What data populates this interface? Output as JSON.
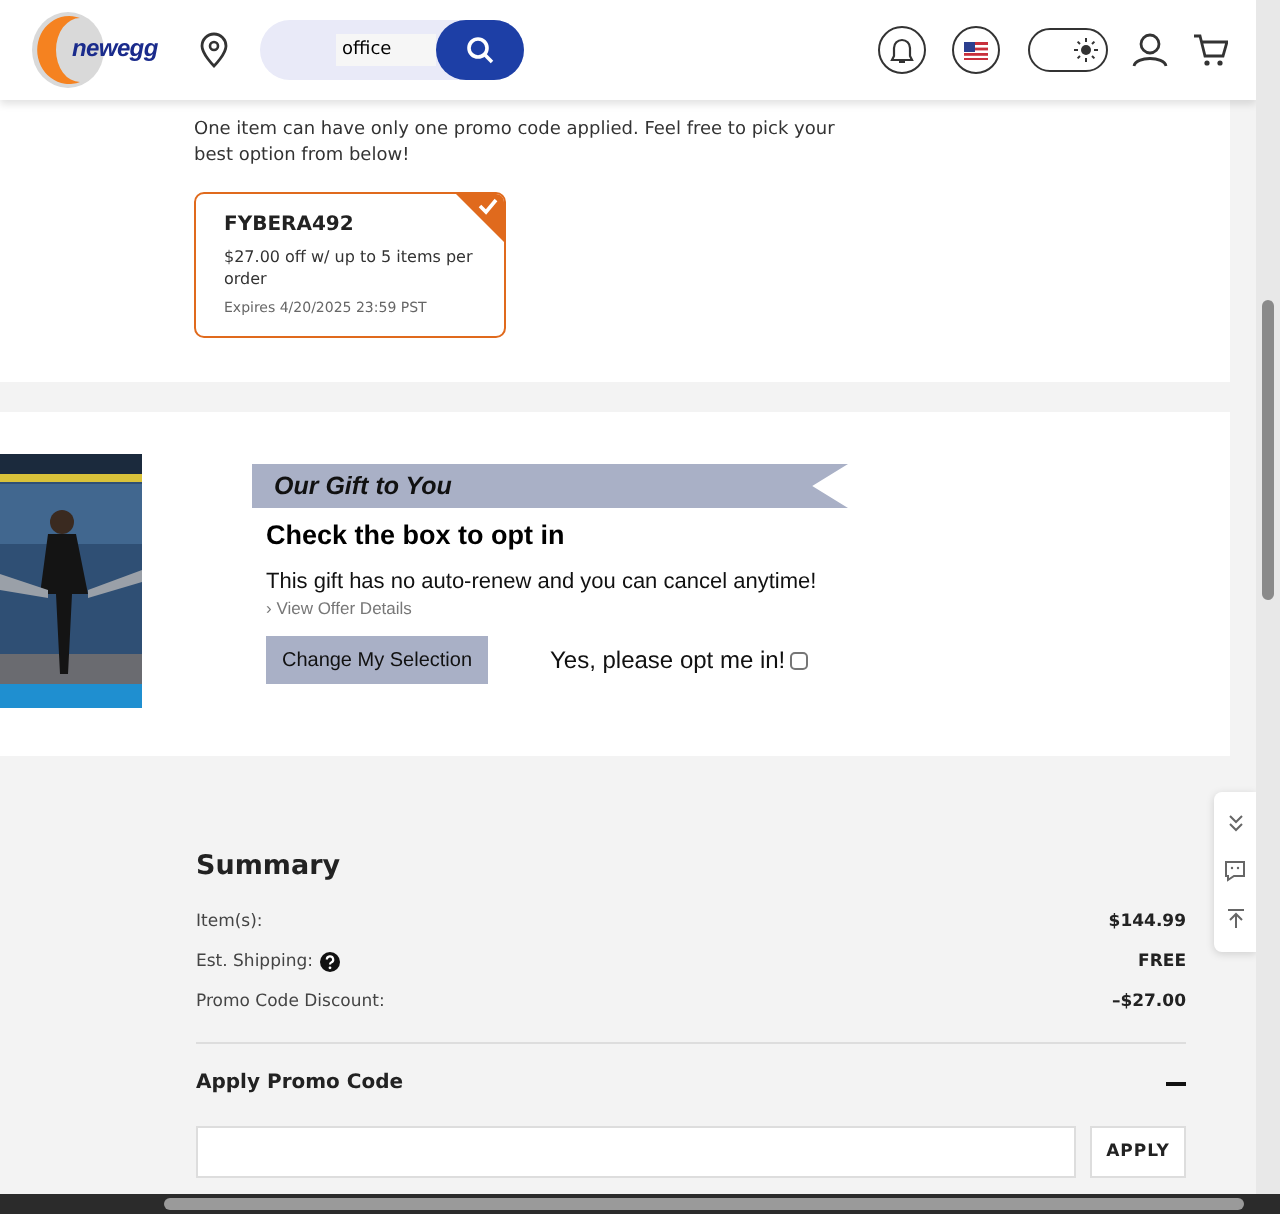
{
  "header": {
    "logo": "newegg",
    "search": {
      "value": "office"
    },
    "dark_mode": {
      "on": false
    }
  },
  "promo": {
    "note": "One item can have only one promo code applied. Feel free to pick your best option from below!",
    "coupons": [
      {
        "code": "FYBERA492",
        "description": "$27.00 off w/ up to 5 items per order",
        "expiry": "Expires 4/20/2025 23:59 PST",
        "selected": true
      }
    ]
  },
  "gift": {
    "kind": "picture",
    "banner": "Our Gift to You",
    "heading": "Check the box to opt in",
    "text": "This gift has no auto-renew and you can cancel anytime!",
    "link": "› View Offer Details",
    "button": "Change My Selection",
    "opt_in": {
      "label": "Yes, please opt me in!",
      "checked": false
    }
  },
  "summary": {
    "title": "Summary",
    "rows": [
      {
        "label": "Item(s):",
        "value": "$144.99",
        "help": false
      },
      {
        "label": "Est. Shipping:",
        "value": "FREE",
        "help": true
      },
      {
        "label": "Promo Code Discount:",
        "value": "–$27.00",
        "help": false
      }
    ],
    "promo_code": {
      "title": "Apply Promo Code",
      "expanded": true,
      "button": "APPLY"
    }
  }
}
